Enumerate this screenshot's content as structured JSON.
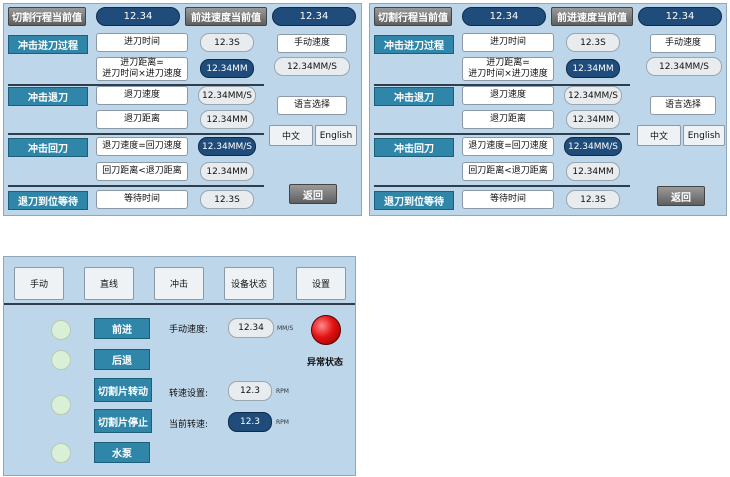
{
  "screen1": {
    "hdr_cut_label": "切割行程当前值",
    "hdr_cut_value": "12.34",
    "hdr_speed_label": "前进速度当前值",
    "hdr_speed_value": "12.34",
    "sec_advance": "冲击进刀过程",
    "advance_time_label": "进刀时间",
    "advance_time_value": "12.3S",
    "advance_dist_label": "进刀距离=\n进刀时间×进刀速度",
    "advance_dist_value": "12.34MM",
    "sec_retract": "冲击退刀",
    "retract_speed_label": "退刀速度",
    "retract_speed_value": "12.34MM/S",
    "retract_dist_label": "退刀距离",
    "retract_dist_value": "12.34MM",
    "sec_return": "冲击回刀",
    "return_speed_label": "退刀速度=回刀速度",
    "return_speed_value": "12.34MM/S",
    "return_dist_label": "回刀距离<退刀距离",
    "return_dist_value": "12.34MM",
    "sec_wait": "退刀到位等待",
    "wait_time_label": "等待时间",
    "wait_time_value": "12.3S",
    "manual_speed_label": "手动速度",
    "manual_speed_value": "12.34MM/S",
    "language_label": "语言选择",
    "chinese_label": "中文",
    "english_label": "English",
    "back_label": "返回"
  },
  "screen3": {
    "tabs": [
      "手动",
      "直线",
      "冲击",
      "设备状态",
      "设置"
    ],
    "forward": "前进",
    "backward": "后退",
    "blade_rotate": "切割片转动",
    "blade_stop": "切割片停止",
    "pump": "水泵",
    "manual_speed_label": "手动速度:",
    "manual_speed_value": "12.34",
    "manual_speed_unit": "MM/S",
    "speed_set_label": "转速设置:",
    "speed_set_value": "12.3",
    "speed_set_unit": "RPM",
    "current_speed_label": "当前转速:",
    "current_speed_value": "12.3",
    "current_speed_unit": "RPM",
    "alarm_label": "异常状态"
  },
  "colors": {
    "panel_bg": "#bdd6ea",
    "navy": "#1f4c7a",
    "teal": "#2f86a8",
    "alarm_red": "#d40000",
    "indicator_green": "#d9f0d6"
  }
}
